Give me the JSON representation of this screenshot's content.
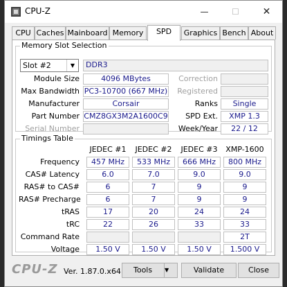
{
  "window": {
    "title": "CPU-Z"
  },
  "tabs": [
    "CPU",
    "Caches",
    "Mainboard",
    "Memory",
    "SPD",
    "Graphics",
    "Bench",
    "About"
  ],
  "slot_group": {
    "title": "Memory Slot Selection",
    "slot": "Slot #2",
    "type": "DDR3",
    "module_size_label": "Module Size",
    "module_size": "4096 MBytes",
    "max_bandwidth_label": "Max Bandwidth",
    "max_bandwidth": "PC3-10700 (667 MHz)",
    "manufacturer_label": "Manufacturer",
    "manufacturer": "Corsair",
    "part_number_label": "Part Number",
    "part_number": "CMZ8GX3M2A1600C9",
    "serial_number_label": "Serial Number",
    "serial_number": "",
    "correction_label": "Correction",
    "correction": "",
    "registered_label": "Registered",
    "registered": "",
    "ranks_label": "Ranks",
    "ranks": "Single",
    "spd_ext_label": "SPD Ext.",
    "spd_ext": "XMP 1.3",
    "week_year_label": "Week/Year",
    "week_year": "22 / 12"
  },
  "timings": {
    "title": "Timings Table",
    "columns": [
      "JEDEC #1",
      "JEDEC #2",
      "JEDEC #3",
      "XMP-1600"
    ],
    "rows": [
      {
        "label": "Frequency",
        "values": [
          "457 MHz",
          "533 MHz",
          "666 MHz",
          "800 MHz"
        ]
      },
      {
        "label": "CAS# Latency",
        "values": [
          "6.0",
          "7.0",
          "9.0",
          "9.0"
        ]
      },
      {
        "label": "RAS# to CAS#",
        "values": [
          "6",
          "7",
          "9",
          "9"
        ]
      },
      {
        "label": "RAS# Precharge",
        "values": [
          "6",
          "7",
          "9",
          "9"
        ]
      },
      {
        "label": "tRAS",
        "values": [
          "17",
          "20",
          "24",
          "24"
        ]
      },
      {
        "label": "tRC",
        "values": [
          "22",
          "26",
          "33",
          "33"
        ]
      },
      {
        "label": "Command Rate",
        "values": [
          "",
          "",
          "",
          "2T"
        ]
      },
      {
        "label": "Voltage",
        "values": [
          "1.50 V",
          "1.50 V",
          "1.50 V",
          "1.500 V"
        ]
      }
    ]
  },
  "footer": {
    "logo": "CPU-Z",
    "version": "Ver. 1.87.0.x64",
    "tools": "Tools",
    "validate": "Validate",
    "close": "Close"
  }
}
